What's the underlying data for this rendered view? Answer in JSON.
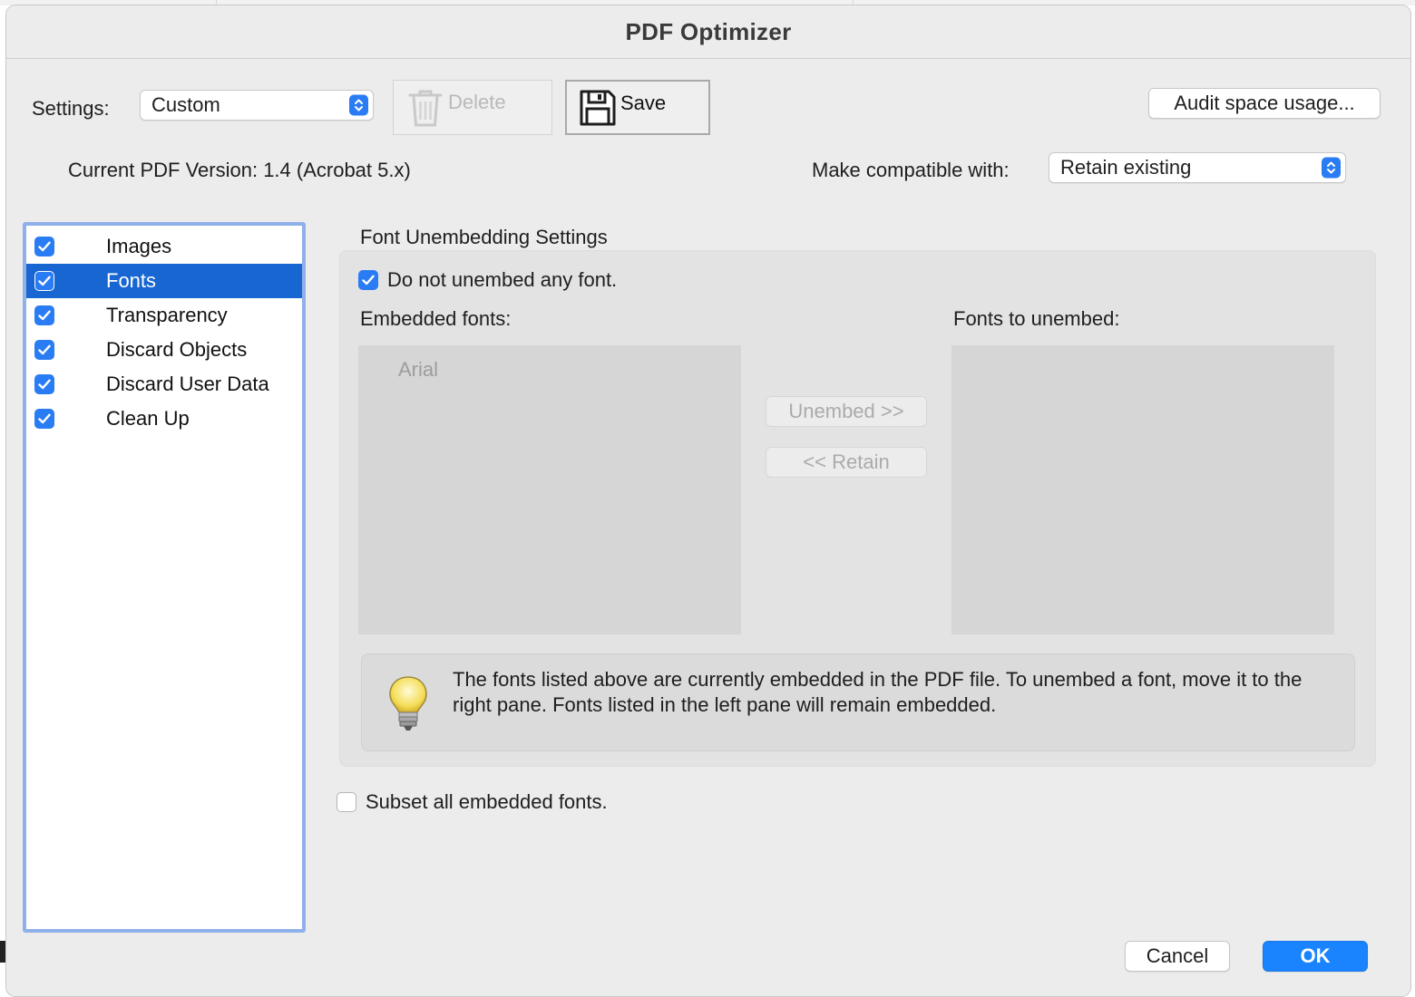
{
  "window": {
    "title": "PDF Optimizer"
  },
  "settings": {
    "label": "Settings:",
    "value": "Custom",
    "delete_label": "Delete",
    "save_label": "Save",
    "audit_label": "Audit space usage..."
  },
  "version": {
    "current": "Current PDF Version: 1.4 (Acrobat 5.x)",
    "compat_label": "Make compatible with:",
    "compat_value": "Retain existing"
  },
  "categories": [
    {
      "label": "Images",
      "checked": true
    },
    {
      "label": "Fonts",
      "checked": true,
      "selected": true
    },
    {
      "label": "Transparency",
      "checked": true
    },
    {
      "label": "Discard Objects",
      "checked": true
    },
    {
      "label": "Discard User Data",
      "checked": true
    },
    {
      "label": "Clean Up",
      "checked": true
    }
  ],
  "fonts_panel": {
    "heading": "Font Unembedding Settings",
    "do_not_unembed": {
      "label": "Do not unembed any font.",
      "checked": true
    },
    "embedded_label": "Embedded fonts:",
    "unembed_label": "Fonts to unembed:",
    "embedded_fonts": [
      "Arial"
    ],
    "unembed_button": "Unembed >>",
    "retain_button": "<< Retain",
    "tip": "The fonts listed above are currently embedded in the PDF file. To unembed a font, move it to the right pane. Fonts listed in the left pane will remain embedded.",
    "subset": {
      "label": "Subset all embedded fonts.",
      "checked": false
    }
  },
  "footer": {
    "cancel": "Cancel",
    "ok": "OK"
  },
  "colors": {
    "accent": "#1a84ff",
    "selection": "#1766d1",
    "window_bg": "#ececec"
  }
}
